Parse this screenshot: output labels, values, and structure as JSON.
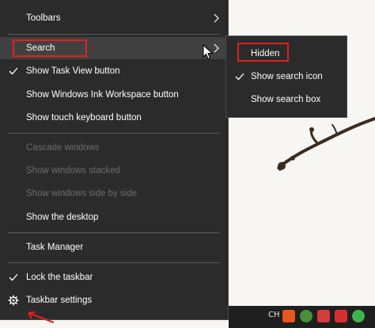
{
  "menu": {
    "items": [
      {
        "label": "Toolbars"
      },
      {
        "label": "Search"
      },
      {
        "label": "Show Task View button"
      },
      {
        "label": "Show Windows Ink Workspace button"
      },
      {
        "label": "Show touch keyboard button"
      },
      {
        "label": "Cascade windows"
      },
      {
        "label": "Show windows stacked"
      },
      {
        "label": "Show windows side by side"
      },
      {
        "label": "Show the desktop"
      },
      {
        "label": "Task Manager"
      },
      {
        "label": "Lock the taskbar"
      },
      {
        "label": "Taskbar settings"
      }
    ]
  },
  "submenu": {
    "items": [
      {
        "label": "Hidden"
      },
      {
        "label": "Show search icon"
      },
      {
        "label": "Show search box"
      }
    ]
  },
  "taskbar": {
    "ime_label": "CH"
  },
  "colors": {
    "menu_bg": "#2b2b2b",
    "highlight": "#e02020",
    "disabled_text": "#6d6d6d"
  },
  "icons": [
    "check-icon",
    "chevron-right-icon",
    "gear-icon",
    "mouse-cursor-icon"
  ]
}
